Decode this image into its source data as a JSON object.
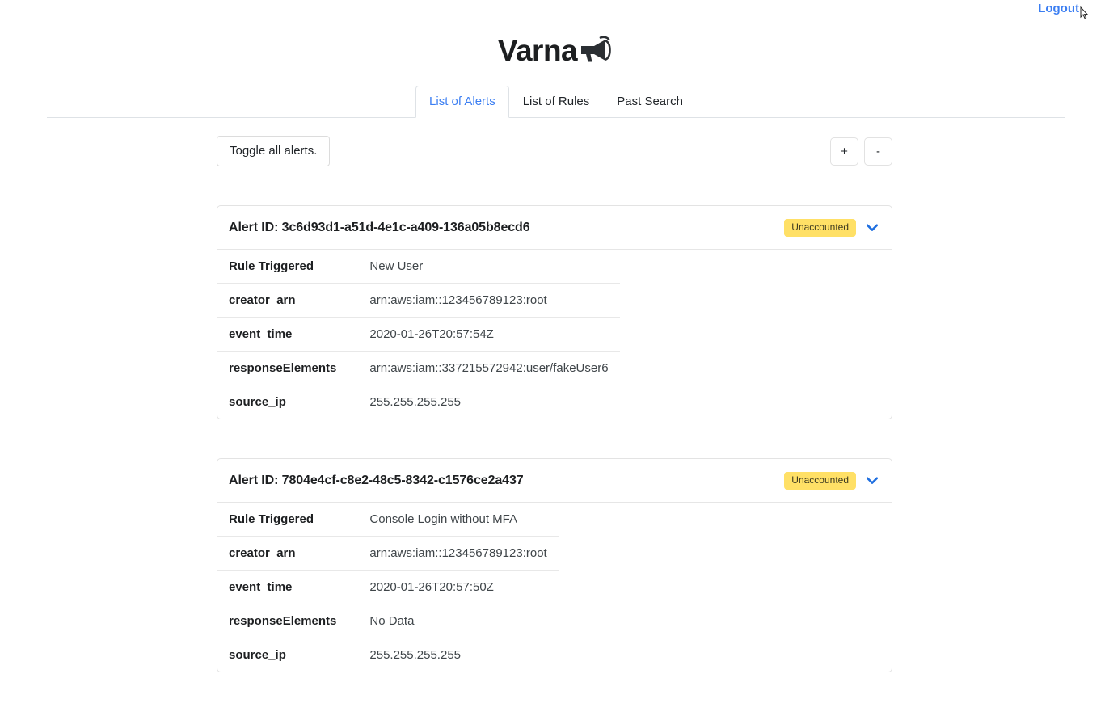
{
  "topbar": {
    "logout_label": "Logout",
    "cursor_icon": "cursor-arrow-icon"
  },
  "brand": {
    "name": "Varna",
    "icon": "megaphone-icon"
  },
  "tabs": [
    {
      "label": "List of Alerts",
      "active": true
    },
    {
      "label": "List of Rules",
      "active": false
    },
    {
      "label": "Past Search",
      "active": false
    }
  ],
  "toolbar": {
    "toggle_all_label": "Toggle all alerts.",
    "zoom_in_label": "+",
    "zoom_out_label": "-"
  },
  "colors": {
    "accent_blue": "#3b7ef2",
    "badge_yellow": "#ffe066",
    "border_gray": "#e3e3e3",
    "text_dark": "#1d1f21"
  },
  "alerts": [
    {
      "id_prefix": "Alert ID: ",
      "id": "3c6d93d1-a51d-4e1c-a409-136a05b8ecd6",
      "id_full": "Alert ID: 3c6d93d1-a51d-4e1c-a409-136a05b8ecd6",
      "status_badge": "Unaccounted",
      "expand_icon": "chevron-down-icon",
      "rows": [
        {
          "key": "Rule Triggered",
          "value": "New User"
        },
        {
          "key": "creator_arn",
          "value": "arn:aws:iam::123456789123:root"
        },
        {
          "key": "event_time",
          "value": "2020-01-26T20:57:54Z"
        },
        {
          "key": "responseElements",
          "value": "arn:aws:iam::337215572942:user/fakeUser6"
        },
        {
          "key": "source_ip",
          "value": "255.255.255.255"
        }
      ]
    },
    {
      "id_prefix": "Alert ID: ",
      "id": "7804e4cf-c8e2-48c5-8342-c1576ce2a437",
      "id_full": "Alert ID: 7804e4cf-c8e2-48c5-8342-c1576ce2a437",
      "status_badge": "Unaccounted",
      "expand_icon": "chevron-down-icon",
      "rows": [
        {
          "key": "Rule Triggered",
          "value": "Console Login without MFA"
        },
        {
          "key": "creator_arn",
          "value": "arn:aws:iam::123456789123:root"
        },
        {
          "key": "event_time",
          "value": "2020-01-26T20:57:50Z"
        },
        {
          "key": "responseElements",
          "value": "No Data"
        },
        {
          "key": "source_ip",
          "value": "255.255.255.255"
        }
      ]
    }
  ]
}
